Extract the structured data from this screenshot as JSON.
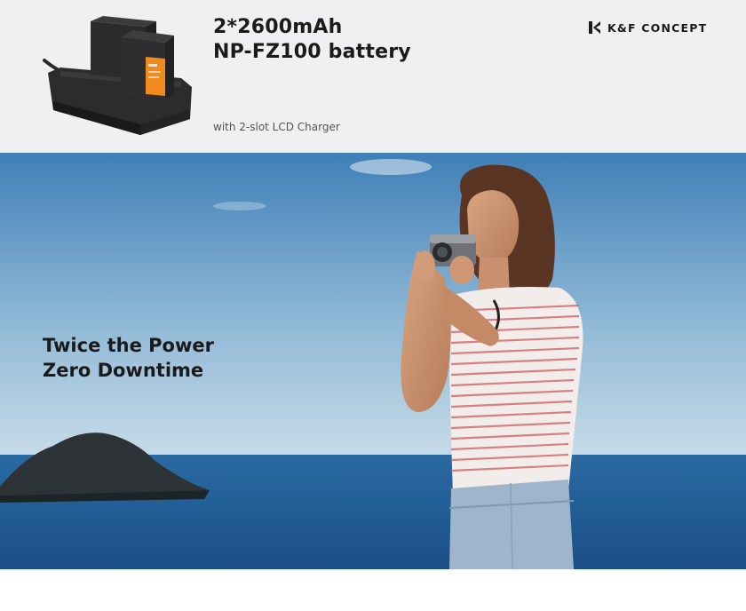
{
  "header": {
    "title_line1": "2*2600mAh",
    "title_line2": "NP-FZ100 battery",
    "subtitle": "with 2-slot LCD Charger",
    "brand": "K&F CONCEPT"
  },
  "hero": {
    "headline_line1": "Twice the Power",
    "headline_line2": "Zero Downtime"
  },
  "icons": {
    "brand_logo": "kf-logo-icon",
    "product": "battery-charger-image"
  },
  "colors": {
    "header_bg": "#f0f0f2",
    "sky_top": "#3f7fb6",
    "sky_bottom": "#c7dbe8",
    "sea": "#1d5a92",
    "text_dark": "#1b1b1b",
    "battery_accent": "#f08a1c"
  }
}
